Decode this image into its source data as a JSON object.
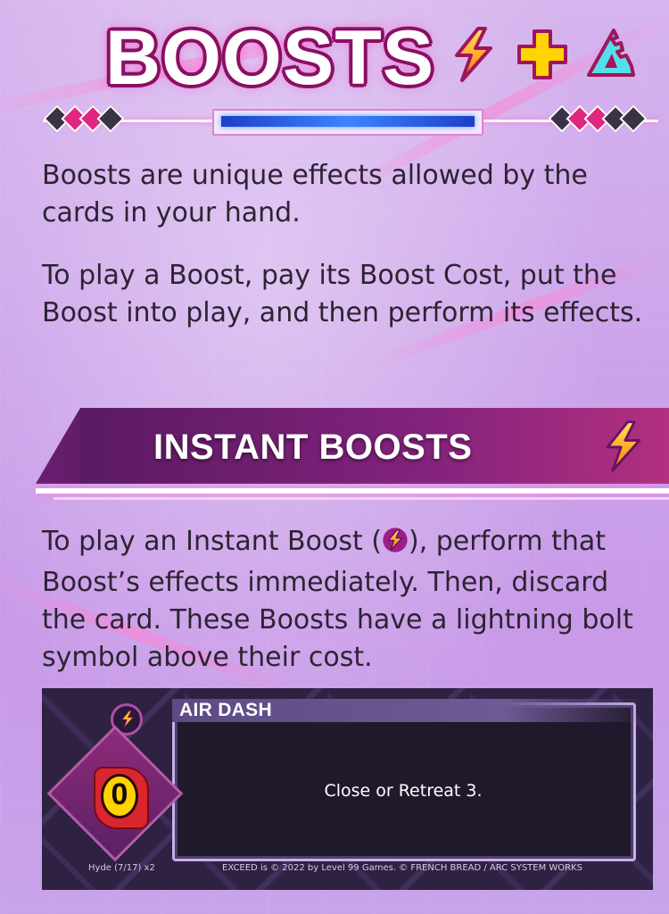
{
  "title": "BOOSTS",
  "title_icons": [
    "lightning-icon",
    "plus-icon",
    "ruler-icon"
  ],
  "intro": {
    "p1": "Boosts are unique effects allowed by the cards in your hand.",
    "p2": "To play a Boost, pay its Boost Cost, put the Boost into play, and then perform its effects."
  },
  "section": {
    "title": "INSTANT BOOSTS",
    "icon": "lightning-icon",
    "text_before": "To play an Instant Boost (",
    "text_after": "), perform that Boost’s effects immediately. Then, discard the card. These Boosts have a lightning bolt symbol above their cost."
  },
  "card": {
    "name": "AIR DASH",
    "cost": "0",
    "effect": "Close or Retreat 3.",
    "footer_left": "Hyde (7/17) x2",
    "footer_right": "EXCEED is © 2022 by Level 99 Games. © FRENCH BREAD / ARC SYSTEM WORKS"
  },
  "colors": {
    "accent_magenta": "#8a0f62",
    "lightning_yellow": "#ffd21a",
    "lightning_orange": "#ff7a00",
    "plus_yellow": "#ffd400",
    "ruler_cyan": "#54e0ea",
    "banner_purple": "#84237d",
    "card_bg": "#2e2142",
    "body_text": "#2d2433"
  }
}
